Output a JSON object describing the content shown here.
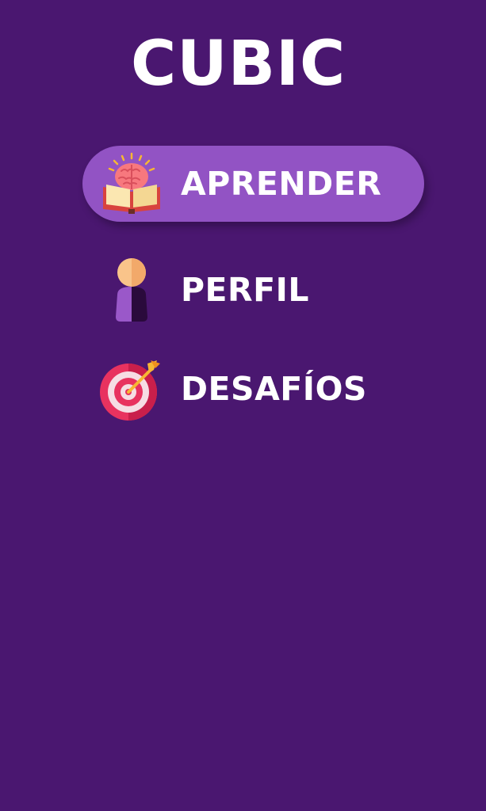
{
  "app": {
    "title": "CUBIC"
  },
  "menu": {
    "items": [
      {
        "label": "APRENDER",
        "icon": "brain-book-icon",
        "active": true
      },
      {
        "label": "PERFIL",
        "icon": "user-icon",
        "active": false
      },
      {
        "label": "DESAFÍOS",
        "icon": "target-icon",
        "active": false
      }
    ]
  },
  "colors": {
    "background": "#4a1770",
    "active_pill": "#9253c4",
    "text": "#ffffff"
  }
}
